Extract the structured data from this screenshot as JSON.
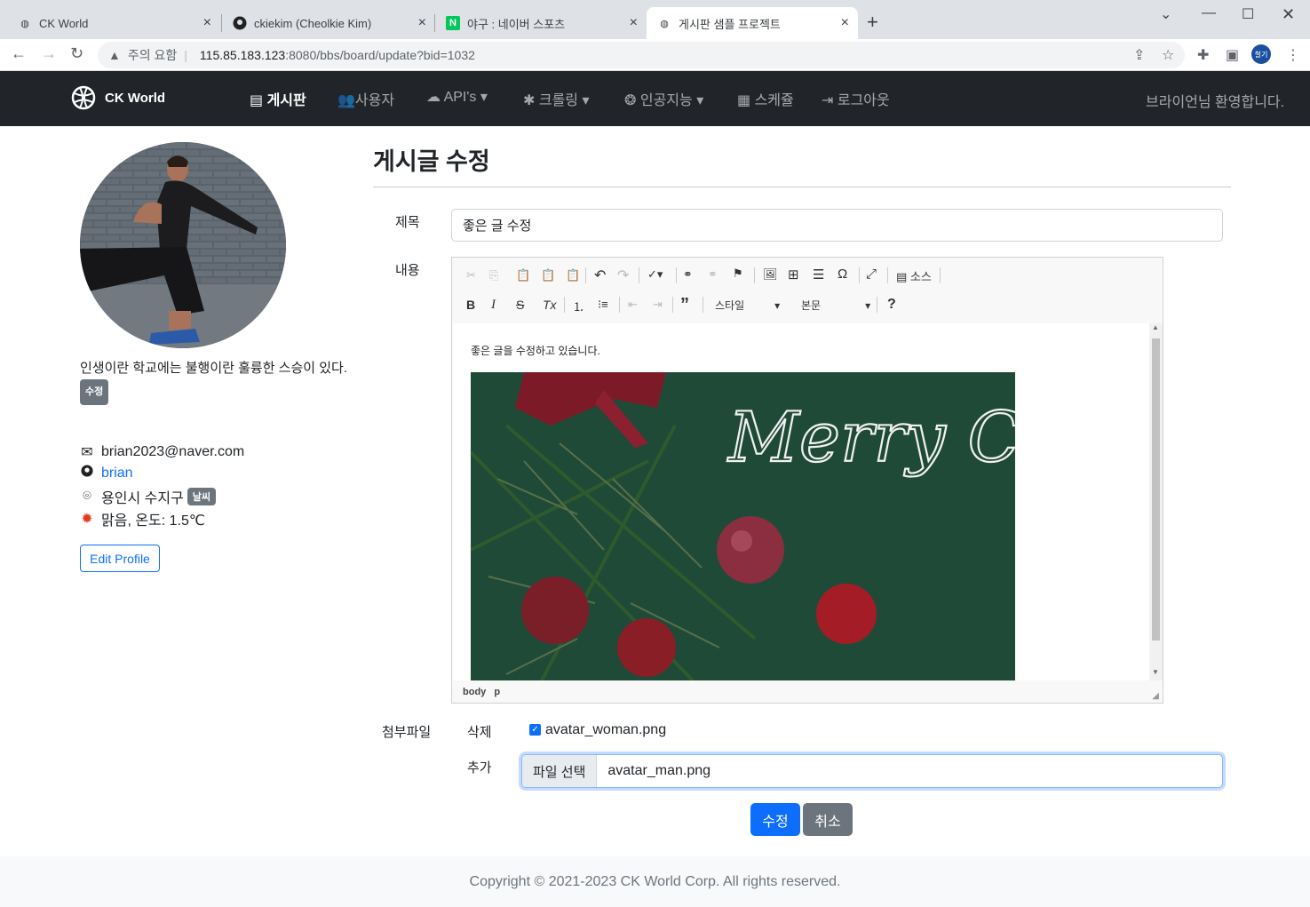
{
  "browser": {
    "tabs": [
      {
        "title": "CK World"
      },
      {
        "title": "ckiekim (Cheolkie Kim)"
      },
      {
        "title": "야구 : 네이버 스포츠"
      },
      {
        "title": "게시판 샘플 프로젝트"
      }
    ],
    "security_label": "주의 요함",
    "url_host": "115.85.183.123",
    "url_path": ":8080/bbs/board/update?bid=1032",
    "profile_label": "철기"
  },
  "navbar": {
    "brand": "CK World",
    "items": [
      {
        "label": "게시판"
      },
      {
        "label": "사용자"
      },
      {
        "label": "API's"
      },
      {
        "label": "크롤링"
      },
      {
        "label": "인공지능"
      },
      {
        "label": "스케쥴"
      },
      {
        "label": "로그아웃"
      }
    ],
    "welcome": "브라이언님 환영합니다."
  },
  "profile": {
    "motto": "인생이란 학교에는 불행이란 훌륭한 스승이 있다.",
    "motto_edit_badge": "수정",
    "email": "brian2023@naver.com",
    "github": "brian",
    "location": "용인시 수지구",
    "weather_badge": "날씨",
    "weather": "맑음, 온도: 1.5℃",
    "edit_button": "Edit Profile"
  },
  "form": {
    "page_title": "게시글 수정",
    "title_label": "제목",
    "title_value": "좋은 글 수정",
    "content_label": "내용",
    "editor": {
      "source_label": "소스",
      "style_select": "스타일",
      "format_select": "본문",
      "content_text": "좋은 글을 수정하고 있습니다.",
      "image_text": "Merry Christmas",
      "path": [
        "body",
        "p"
      ]
    },
    "attach_label": "첨부파일",
    "delete_label": "삭제",
    "existing_file": "avatar_woman.png",
    "delete_checked": true,
    "add_label": "추가",
    "file_button": "파일 선택",
    "new_file": "avatar_man.png",
    "submit_button": "수정",
    "cancel_button": "취소"
  },
  "footer": {
    "copyright": "Copyright © 2021-2023 CK World Corp. All rights reserved."
  },
  "colors": {
    "primary": "#0d6efd",
    "secondary": "#6c757d",
    "navbar_bg": "#212529"
  }
}
